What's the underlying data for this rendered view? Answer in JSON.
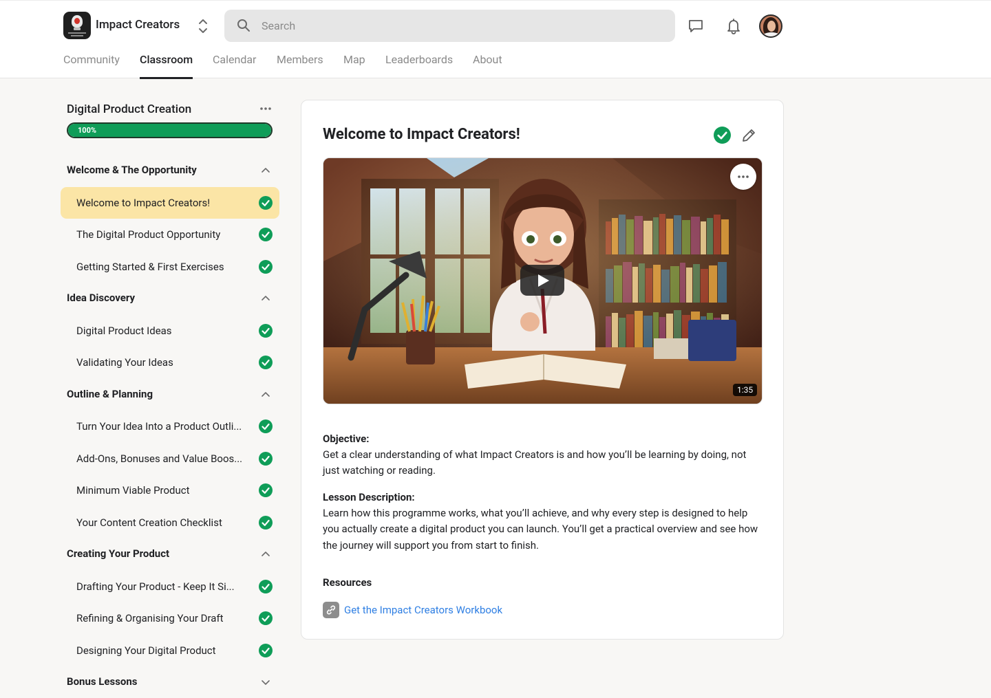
{
  "header": {
    "brand_name": "Impact Creators",
    "search_placeholder": "Search",
    "icons": [
      "switcher-chevrons-icon",
      "search-icon",
      "chat-icon",
      "bell-icon"
    ]
  },
  "tabs": [
    {
      "label": "Community",
      "active": false
    },
    {
      "label": "Classroom",
      "active": true
    },
    {
      "label": "Calendar",
      "active": false
    },
    {
      "label": "Members",
      "active": false
    },
    {
      "label": "Map",
      "active": false
    },
    {
      "label": "Leaderboards",
      "active": false
    },
    {
      "label": "About",
      "active": false
    }
  ],
  "course": {
    "title": "Digital Product Creation",
    "progress_label": "100%",
    "progress_fraction": 1.0
  },
  "sections": [
    {
      "title": "Welcome & The Opportunity",
      "expanded": true,
      "lessons": [
        {
          "label": "Welcome to Impact Creators!",
          "completed": true,
          "active": true
        },
        {
          "label": "The Digital Product Opportunity",
          "completed": true,
          "active": false
        },
        {
          "label": "Getting Started & First Exercises",
          "completed": true,
          "active": false
        }
      ]
    },
    {
      "title": "Idea Discovery",
      "expanded": true,
      "lessons": [
        {
          "label": "Digital Product Ideas",
          "completed": true,
          "active": false
        },
        {
          "label": "Validating Your Ideas",
          "completed": true,
          "active": false
        }
      ]
    },
    {
      "title": "Outline & Planning",
      "expanded": true,
      "lessons": [
        {
          "label": "Turn Your Idea Into a Product Outli...",
          "completed": true,
          "active": false
        },
        {
          "label": "Add-Ons, Bonuses and Value Boos...",
          "completed": true,
          "active": false
        },
        {
          "label": "Minimum Viable Product",
          "completed": true,
          "active": false
        },
        {
          "label": "Your Content Creation Checklist",
          "completed": true,
          "active": false
        }
      ]
    },
    {
      "title": "Creating Your Product",
      "expanded": true,
      "lessons": [
        {
          "label": "Drafting Your Product - Keep It Si...",
          "completed": true,
          "active": false
        },
        {
          "label": "Refining & Organising Your Draft",
          "completed": true,
          "active": false
        },
        {
          "label": "Designing Your Digital Product",
          "completed": true,
          "active": false
        }
      ]
    },
    {
      "title": "Bonus Lessons",
      "expanded": false,
      "lessons": []
    }
  ],
  "lesson": {
    "title": "Welcome to Impact Creators!",
    "completed": true,
    "video": {
      "duration": "1:35"
    },
    "objective_label": "Objective:",
    "objective_text": "Get a clear understanding of what Impact Creators is and how you’ll be learning by doing, not just watching or reading.",
    "description_label": "Lesson Description:",
    "description_text": "Learn how this programme works, what you’ll achieve, and why every step is designed to help you actually create a digital product you can launch. You’ll get a practical overview and see how the journey will support you from start to finish.",
    "resources_label": "Resources",
    "resource_link": "Get the Impact Creators Workbook"
  },
  "colors": {
    "accent_green": "#0f9d58",
    "active_lesson_bg": "#fbe5a6",
    "link_blue": "#2f7fe3"
  }
}
